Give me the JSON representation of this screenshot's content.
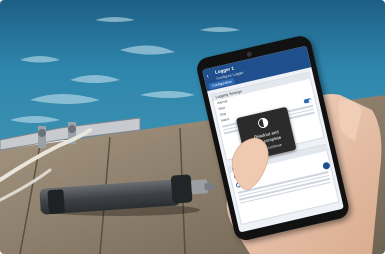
{
  "app": {
    "title": "Logger 1",
    "subtitle": "Configure Logger",
    "tab_label": "Configuration",
    "back_icon": "back-arrow-icon"
  },
  "settings_section": {
    "heading": "Logging Settings",
    "rows": [
      "Interval",
      "Start",
      "Stop",
      "Alarm"
    ]
  },
  "second_section": {
    "heading": "Readout and Battery",
    "options": [
      "Immediate",
      "Configured"
    ]
  },
  "toast": {
    "icon": "half-circle-progress-icon",
    "line1": "Readout and",
    "line2": "data complete",
    "line3": "Tap to continue"
  },
  "colors": {
    "water": "#2f7fa8",
    "dock": "#8a7b66",
    "app_bar": "#1f4f8c",
    "logger_body": "#4a4e52"
  }
}
